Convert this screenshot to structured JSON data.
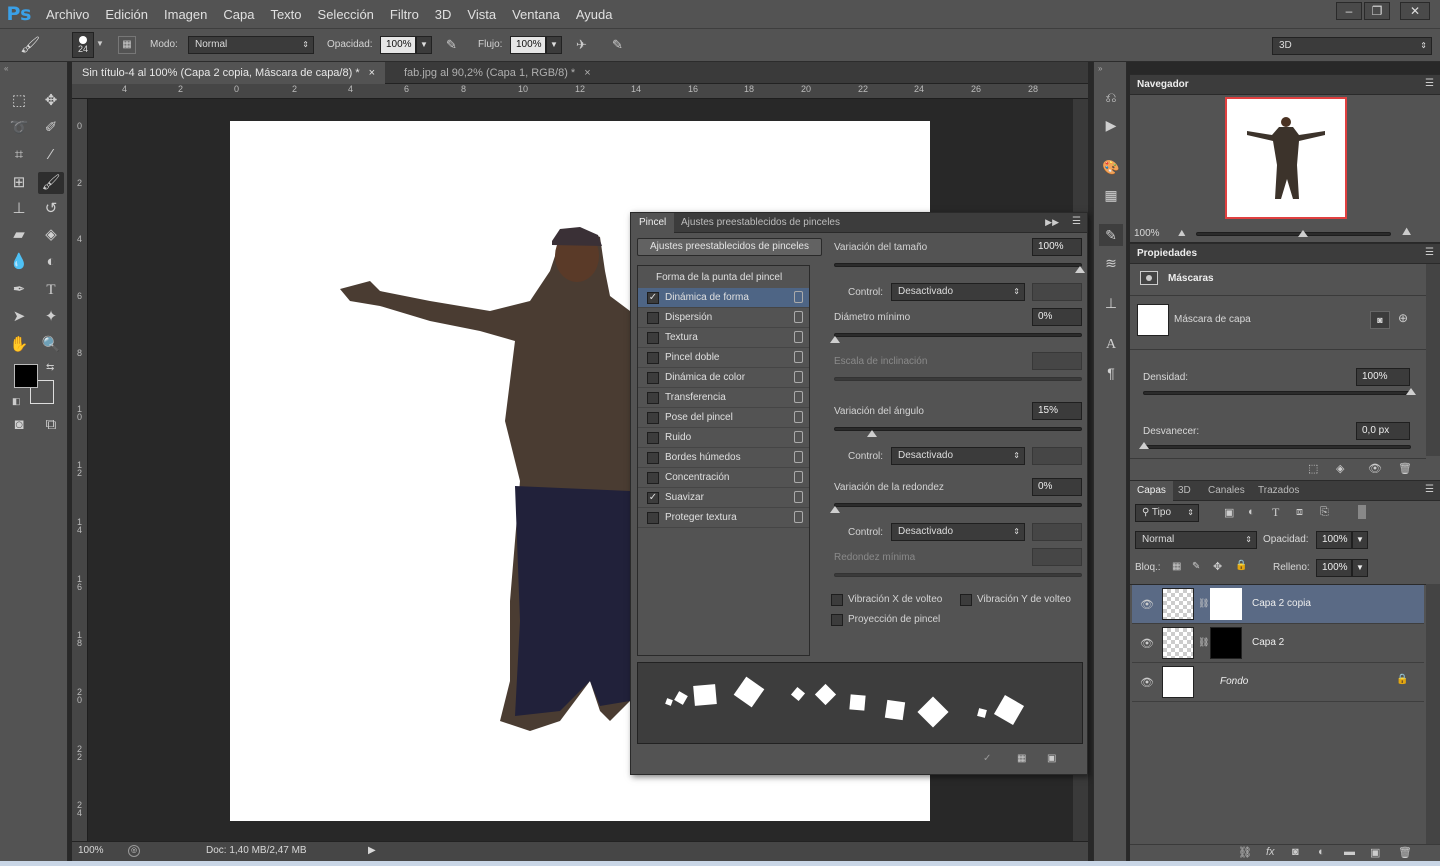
{
  "app": {
    "logo": "Ps"
  },
  "menu": [
    "Archivo",
    "Edición",
    "Imagen",
    "Capa",
    "Texto",
    "Selección",
    "Filtro",
    "3D",
    "Vista",
    "Ventana",
    "Ayuda"
  ],
  "window_buttons": [
    "‒",
    "❐",
    "✕"
  ],
  "options": {
    "brush_size": "24",
    "mode_label": "Modo:",
    "mode_value": "Normal",
    "opacity_label": "Opacidad:",
    "opacity_value": "100%",
    "flow_label": "Flujo:",
    "flow_value": "100%",
    "workspace": "3D"
  },
  "doc_tabs": [
    {
      "label": "Sin título-4 al 100% (Capa 2 copia, Máscara de capa/8) *",
      "close": "×"
    },
    {
      "label": "fab.jpg al 90,2% (Capa 1, RGB/8) *",
      "close": "×"
    }
  ],
  "ruler_h": [
    "4",
    "2",
    "0",
    "2",
    "4",
    "6",
    "8",
    "10",
    "12",
    "14",
    "16",
    "18",
    "20",
    "22",
    "24",
    "26",
    "28"
  ],
  "ruler_v": [
    "0",
    "2",
    "4",
    "6",
    "8",
    "1 0",
    "1 2",
    "1 4",
    "1 6",
    "1 8",
    "2 0",
    "2 2",
    "2 4"
  ],
  "status": {
    "zoom": "100%",
    "doc": "Doc: 1,40 MB/2,47 MB"
  },
  "brush_panel": {
    "tabs": [
      "Pincel",
      "Ajustes preestablecidos de pinceles"
    ],
    "preset_button": "Ajustes preestablecidos de pinceles",
    "tip_shape": "Forma de la punta del pincel",
    "options": [
      {
        "label": "Dinámica de forma",
        "checked": true
      },
      {
        "label": "Dispersión",
        "checked": false
      },
      {
        "label": "Textura",
        "checked": false
      },
      {
        "label": "Pincel doble",
        "checked": false
      },
      {
        "label": "Dinámica de color",
        "checked": false
      },
      {
        "label": "Transferencia",
        "checked": false
      },
      {
        "label": "Pose del pincel",
        "checked": false
      },
      {
        "label": "Ruido",
        "checked": false
      },
      {
        "label": "Bordes húmedos",
        "checked": false
      },
      {
        "label": "Concentración",
        "checked": false
      },
      {
        "label": "Suavizar",
        "checked": true
      },
      {
        "label": "Proteger textura",
        "checked": false
      }
    ],
    "size_jitter_label": "Variación del tamaño",
    "size_jitter_value": "100%",
    "control_label": "Control:",
    "control_value": "Desactivado",
    "min_diameter_label": "Diámetro mínimo",
    "min_diameter_value": "0%",
    "tilt_scale_label": "Escala de inclinación",
    "angle_jitter_label": "Variación del ángulo",
    "angle_jitter_value": "15%",
    "roundness_jitter_label": "Variación de la redondez",
    "roundness_jitter_value": "0%",
    "min_roundness_label": "Redondez mínima",
    "flip_x_label": "Vibración X de volteo",
    "flip_y_label": "Vibración Y de volteo",
    "projection_label": "Proyección de pincel",
    "check_mark": "✓"
  },
  "navigator": {
    "title": "Navegador",
    "zoom": "100%"
  },
  "properties": {
    "title": "Propiedades",
    "section": "Máscaras",
    "mask_label": "Máscara de capa",
    "density_label": "Densidad:",
    "density_value": "100%",
    "feather_label": "Desvanecer:",
    "feather_value": "0,0 px"
  },
  "layers_panel": {
    "tabs": [
      "Capas",
      "3D",
      "Canales",
      "Trazados"
    ],
    "filter_kind": "Tipo",
    "blend_mode": "Normal",
    "opacity_label": "Opacidad:",
    "opacity_value": "100%",
    "lock_label": "Bloq.:",
    "fill_label": "Relleno:",
    "fill_value": "100%",
    "layers": [
      {
        "name": "Capa 2 copia",
        "selected": true,
        "mask": "white"
      },
      {
        "name": "Capa 2",
        "selected": false,
        "mask": "black"
      },
      {
        "name": "Fondo",
        "selected": false,
        "mask": "none"
      }
    ]
  },
  "colors": {
    "ui": "#535353",
    "dark": "#282828",
    "highlight": "#4e6585",
    "accent": "#3aa0e8"
  }
}
